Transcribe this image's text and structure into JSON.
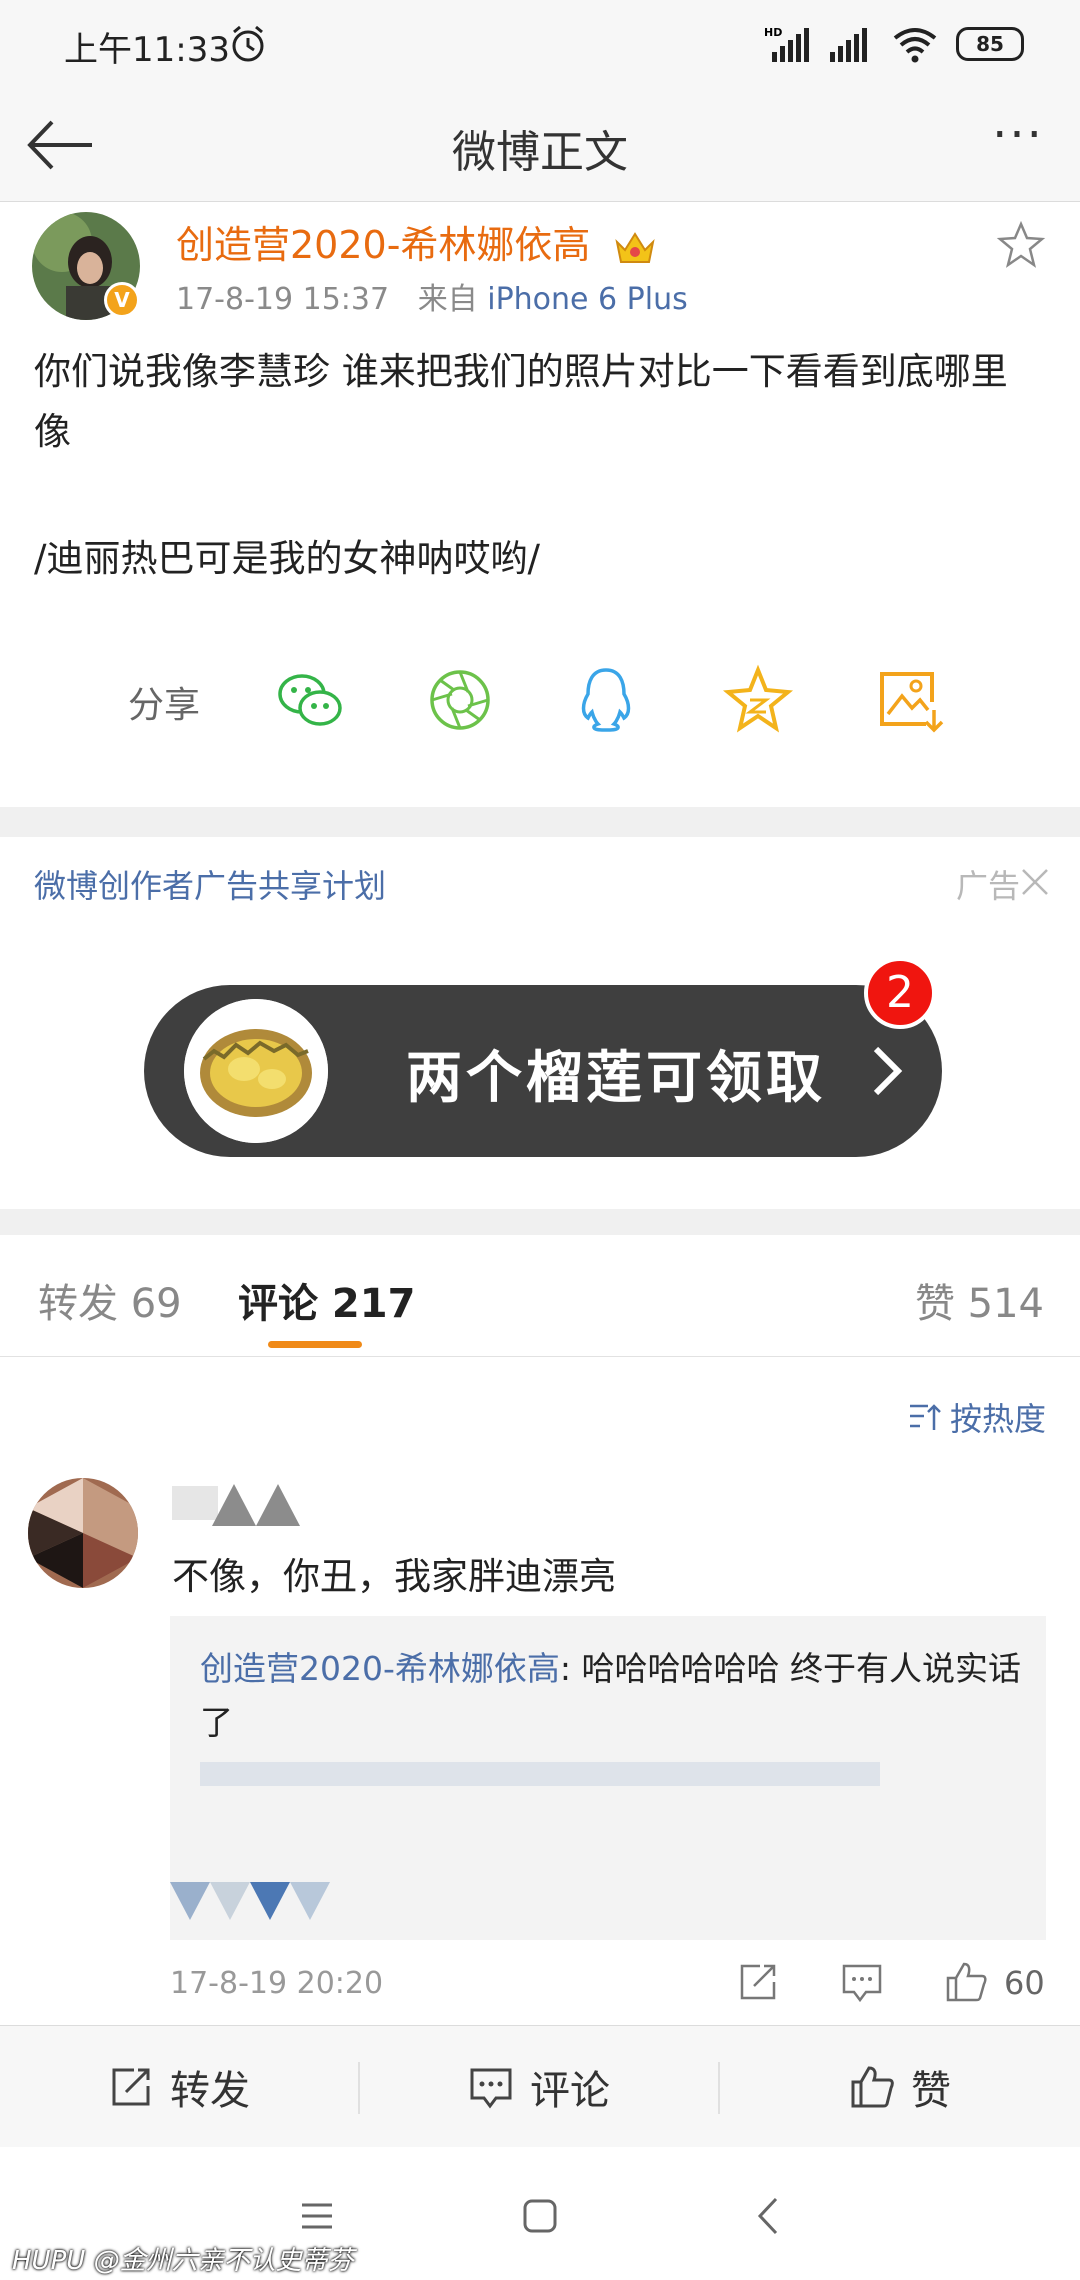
{
  "status_bar": {
    "time": "上午11:33",
    "battery": "85"
  },
  "header": {
    "title": "微博正文"
  },
  "post": {
    "author": "创造营2020-希林娜依高",
    "time": "17-8-19 15:37",
    "from_label": "来自",
    "device": "iPhone 6 Plus",
    "text": "你们说我像李慧珍 谁来把我们的照片对比一下看看到底哪里像",
    "text2": "/迪丽热巴可是我的女神呐哎哟/",
    "share_label": "分享",
    "share_icons": [
      "wechat-icon",
      "moments-icon",
      "qq-icon",
      "star-favorite-icon",
      "save-image-icon"
    ]
  },
  "ad": {
    "title": "微博创作者广告共享计划",
    "label": "广告",
    "banner_text": "两个榴莲可领取",
    "badge": "2"
  },
  "tabs": {
    "repost": "转发 69",
    "comments": "评论 217",
    "likes": "赞 514"
  },
  "sort_label": "按热度",
  "comment": {
    "text": "不像，你丑，我家胖迪漂亮",
    "reply_author": "创造营2020-希林娜依高",
    "reply_text": ": 哈哈哈哈哈哈 终于有人说实话了",
    "time": "17-8-19 20:20",
    "likes": "60"
  },
  "toolbar": {
    "repost": "转发",
    "comment": "评论",
    "like": "赞"
  },
  "watermark": {
    "brand": "HUPU",
    "user": "@金州六亲不认史蒂芬"
  },
  "colors": {
    "link": "#4b6ea8",
    "author_orange": "#e86b10",
    "accent_orange": "#f08a18",
    "badge_red": "#f0150f"
  }
}
